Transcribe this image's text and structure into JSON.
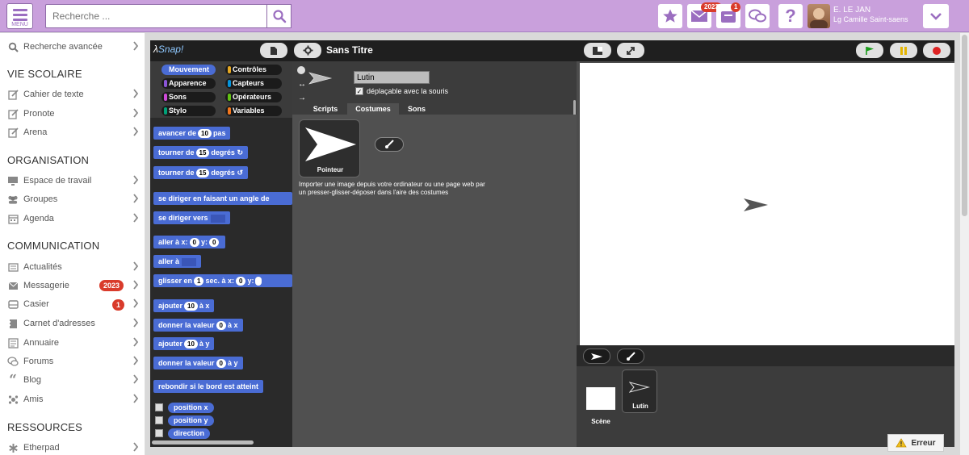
{
  "topbar": {
    "menu_label": "MENU",
    "search_placeholder": "Recherche ...",
    "messages_badge": "2023",
    "casier_badge": "1",
    "help_label": "?",
    "user_name": "E. LE JAN",
    "user_school": "Lg Camille Saint-saens"
  },
  "sidebar": {
    "advanced_search": "Recherche avancée",
    "sections": [
      {
        "title": "VIE SCOLAIRE",
        "items": [
          "Cahier de texte",
          "Pronote",
          "Arena"
        ]
      },
      {
        "title": "ORGANISATION",
        "items": [
          "Espace de travail",
          "Groupes",
          "Agenda"
        ]
      },
      {
        "title": "COMMUNICATION",
        "items": [
          "Actualités",
          "Messagerie",
          "Casier",
          "Carnet d'adresses",
          "Annuaire",
          "Forums",
          "Blog",
          "Amis"
        ]
      },
      {
        "title": "RESSOURCES",
        "items": [
          "Etherpad"
        ]
      }
    ],
    "messagerie_badge": "2023",
    "casier_badge": "1"
  },
  "snap": {
    "logo": "Snap!",
    "project_title": "Sans Titre",
    "categories": [
      "Mouvement",
      "Contrôles",
      "Apparence",
      "Capteurs",
      "Sons",
      "Opérateurs",
      "Stylo",
      "Variables"
    ],
    "category_colors": [
      "#4a6cd4",
      "#e6a822",
      "#8a55d7",
      "#0494dc",
      "#cf4ad9",
      "#62c213",
      "#00a178",
      "#f3761d"
    ],
    "blocks": {
      "b1_pre": "avancer de",
      "b1_v": "10",
      "b1_post": "pas",
      "b2_pre": "tourner de",
      "b2_v": "15",
      "b2_post": "degrés",
      "b3_pre": "tourner de",
      "b3_v": "15",
      "b3_post": "degrés",
      "b4": "se diriger en faisant un angle de",
      "b5": "se diriger vers",
      "b6_pre": "aller à x:",
      "b6_x": "0",
      "b6_mid": "y:",
      "b6_y": "0",
      "b7": "aller à",
      "b8_pre": "glisser en",
      "b8_v": "1",
      "b8_mid": "sec. à x:",
      "b8_x": "0",
      "b8_y_lbl": "y:",
      "b9_pre": "ajouter",
      "b9_v": "10",
      "b9_post": "à x",
      "b10_pre": "donner la valeur",
      "b10_v": "0",
      "b10_post": "à x",
      "b11_pre": "ajouter",
      "b11_v": "10",
      "b11_post": "à y",
      "b12_pre": "donner la valeur",
      "b12_v": "0",
      "b12_post": "à y",
      "b13": "rebondir si le bord est atteint",
      "r1": "position x",
      "r2": "position y",
      "r3": "direction"
    },
    "sprite_name": "Lutin",
    "draggable_label": "déplaçable avec la souris",
    "tabs": [
      "Scripts",
      "Costumes",
      "Sons"
    ],
    "costume_name": "Pointeur",
    "import_text": "Importer une image depuis votre ordinateur ou une page web par un presser-glisser-déposer dans l'aire des costumes",
    "scene_label": "Scène",
    "sprite_tile_label": "Lutin"
  },
  "error_label": "Erreur"
}
